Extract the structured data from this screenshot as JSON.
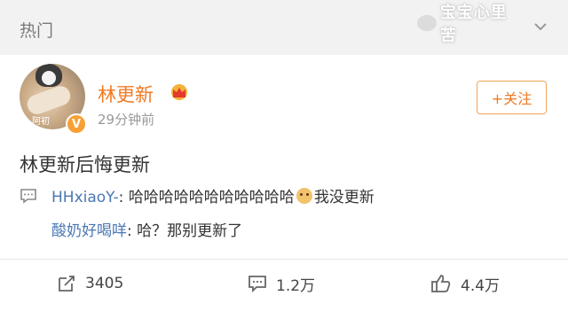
{
  "header": {
    "title": "热门",
    "watermark": "宝宝心里苦"
  },
  "post": {
    "username": "林更新",
    "timestamp": "29分钟前",
    "follow_label": "+关注",
    "text": "林更新后悔更新",
    "avatar_caption": "阿初",
    "verified_mark": "V",
    "comments": [
      {
        "name": "HHxiaoY-",
        "sep": ": ",
        "text_before": "哈哈哈哈哈哈哈哈哈哈哈",
        "text_after": "我没更新"
      },
      {
        "name": "酸奶好喝咩",
        "sep": ": ",
        "text_before": "哈？那别更新了",
        "text_after": ""
      }
    ],
    "actions": {
      "repost_count": "3405",
      "comment_count": "1.2万",
      "like_count": "4.4万"
    }
  },
  "colors": {
    "accent": "#f07a22",
    "link": "#4a77b3",
    "header_bg": "#f2f2f2"
  },
  "icons": {
    "chevron": "chevron-down-icon",
    "crown": "crown-icon",
    "comment": "comment-icon",
    "repost": "repost-icon",
    "like": "like-icon"
  }
}
